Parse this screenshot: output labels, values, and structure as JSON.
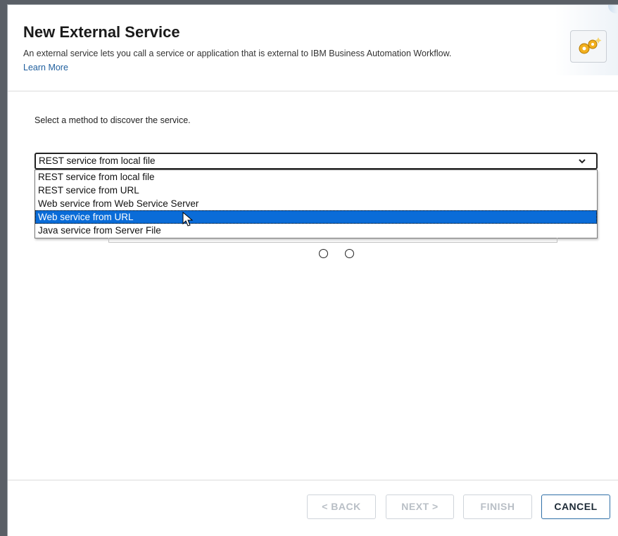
{
  "dialog": {
    "title": "New External Service",
    "description": "An external service lets you call a service or application that is external to IBM Business Automation Workflow.",
    "learn_more": "Learn More",
    "icon": "gears-icon"
  },
  "discovery": {
    "prompt": "Select a method to discover the service.",
    "selected_value": "REST service from local file",
    "highlighted_option": "Web service from URL",
    "options": [
      "REST service from local file",
      "REST service from URL",
      "Web service from Web Service Server",
      "Web service from URL",
      "Java service from Server File"
    ]
  },
  "footer": {
    "back_label": "< BACK",
    "next_label": "NEXT >",
    "finish_label": "FINISH",
    "cancel_label": "CANCEL"
  },
  "colors": {
    "accent": "#0a6cd8",
    "link": "#1f5f9e",
    "cancel_border": "#2f6fa7"
  }
}
